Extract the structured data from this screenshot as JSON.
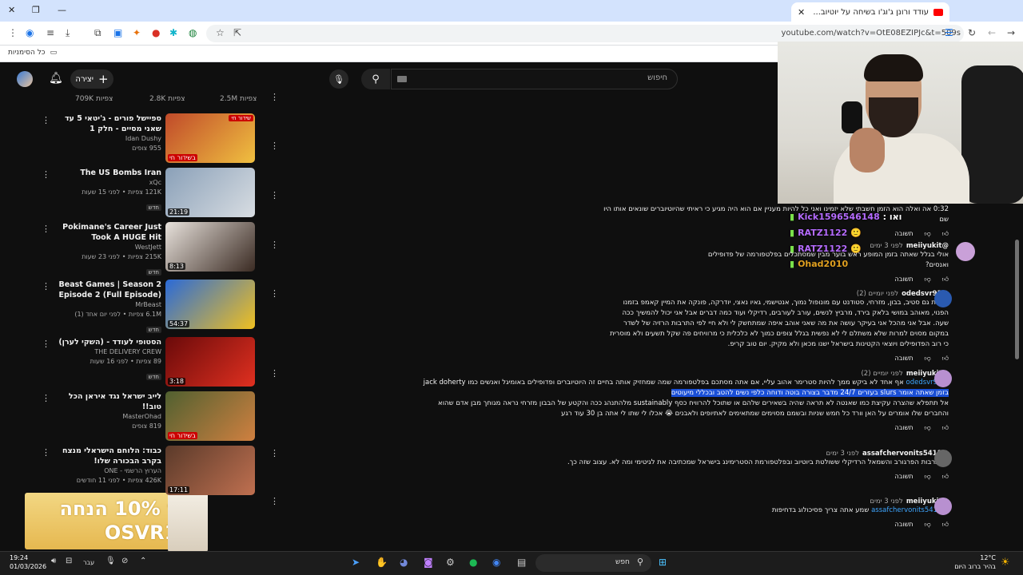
{
  "browser": {
    "tab_title": "עודד ורונן ג'וג'ו בשיחה על יוטיוב...",
    "url": "youtube.com/watch?v=OtE08EZIPJc&t=509s",
    "bookmarks_label": "כל הסימניות"
  },
  "header": {
    "create_label": "יצירה",
    "search_placeholder": "חיפוש"
  },
  "sidebar": {
    "top_views": [
      "709K צפיות",
      "2.8K צפיות",
      "2.5M צפיות"
    ],
    "videos": [
      {
        "title": "ספיישל פורים - ג'יטאי 5 עד שאני מסיים - חלק 1",
        "channel": "Idan Dushy",
        "stats": "955 צופים",
        "badge": "בשידור חי",
        "thumb_badge": "שידור חי"
      },
      {
        "title": "The US Bombs Iran",
        "channel": "xQc",
        "stats": "121K צפיות • לפני 15 שעות",
        "new": "חדש",
        "duration": "21:19"
      },
      {
        "title": "Pokimane's Career Just Took A HUGE Hit",
        "channel": "WestJett",
        "stats": "215K צפיות • לפני 23 שעות",
        "new": "חדש",
        "duration": "8:13"
      },
      {
        "title": "Beast Games | Season 2 Episode 2 (Full Episode)",
        "channel": "MrBeast",
        "stats": "6.1M צפיות • לפני יום אחד (1)",
        "new": "חדש",
        "duration": "54:37"
      },
      {
        "title": "הסטופי לעודד - (השקי לערן)",
        "channel": "THE DELIVERY CREW",
        "stats": "89 צפיות • לפני 16 שעות",
        "new": "חדש",
        "duration": "3:18"
      },
      {
        "title": "לייב ישראל נגד איראן הכל טוב!!",
        "channel": "MasterOhad",
        "stats": "819 צופים",
        "badge": "בשידור חי"
      },
      {
        "title": "כבוד: הלוחם הישראלי מנצח בקרב הבכורה שלו!",
        "channel": "הערוץ הרשמי - ONE",
        "stats": "426K צפיות • לפני 11 חודשים",
        "duration": "17:11"
      }
    ]
  },
  "ad": {
    "line1": "קוד 10% הנחה",
    "line2": "OSVR10"
  },
  "chat": [
    {
      "user": "Kick1596546148",
      "suffix": ": ואו"
    },
    {
      "user": "RATZ1122",
      "suffix": ""
    },
    {
      "user": "RATZ1122",
      "suffix": ""
    },
    {
      "user": "Ohad2010",
      "suffix": ""
    }
  ],
  "comments": [
    {
      "author": "",
      "time": "",
      "body": "0:32 אה ואלה הוא הזמן חשבתי שלא יזמינו ואני כל להיות מעניין אם הוא היה מגיע כי ראיתי שהיוטיוברים שונאים אותו היו שם",
      "reply": "תשובה"
    },
    {
      "author": "@meiiyukit",
      "time": "לפני 3 ימים",
      "body": "אולי בגלל שאתה בזמן המופע ראש בוער מבין שמסתכלים בפלטפורמה של פדופילים ואנסים?",
      "reply": "תשובה"
    },
    {
      "author": "@odedsvr95",
      "time": "לפני יומיים (2)",
      "body": "שכחת גם סטיב, בבון, מזרחי, סטודנט עם מונופול נמוך, אנטישמי, גאיו נאצי, יודרקה, פונקה את המיין קאמפ בזמנו הפנוי, מאוהב במושי בלאק בירד, מרביץ לנשים, עורב לעורבים, רדיקלי ועוד כמה דברים אבל אני יכול להמשיך ככה שעה. אבל אני מהכל אני בעיקר עושה את מה שאני אוהב איפה שמתחשק לי ולא חיי לפי התרבות הרזיה של לשדר במקום מסוים למרות שלא משתלם לי לא נפשית בגלל צופים כמוך לא כלכלית כי מרוויחים פה שקל תשעים ולא מוסרית כי רוב הפדופילים ויוצאי הקטינות בישראל ישנו מכאן ולא מקיק. יום טוב קריפ.",
      "reply": "תשובה"
    },
    {
      "author": "@meiiyukit",
      "time": "לפני יומיים (2)",
      "mention": "@odedsvr95",
      "body_pre": "אף אחד לא ביקש ממך להיות סטרימר אהוב עליי, אם אתה מסתכם בפלטפורמה שמה שמחזיק אותה בחיים זה היוטיוברים ופדופילים באומיגל ואנשים כמו jack doherty",
      "highlight": "בזמן שאתה אומר slurs בעזרים 24/7 מדבר בצורה בוטה ודוחה כלפי נשים להטב ובכללי מיעוטים",
      "body_post": "אל תתפלא שהצרה עקיצת כמו שאנטה לא תראה שהיה בשאירים שלהם או שתוכל להרוויח כסף sustainably מלהתנהג ככה והקטע של הבבון מזרחי נראה מגוחך מבן אדם שהוא והחברים שלו אומרים על האן וורד כל חמש שניות ובשמם מסוימים שמתאימים לאתיופים ולאבנים 😭 אכלו לי שתו לי אתה בן 30 עוד רגע",
      "reply": "תשובה"
    },
    {
      "author": "@assafchervonits5411",
      "time": "לפני 3 ימים",
      "body": "זה תרבות הפרגורב והשמאל הרדיקלי ששולטת ביוטיוב ובפלטפורמת הסטרימינג בישראל שמכתיבה את לגיטימי ומה לא. עצוב שזה כך.",
      "reply": "תשובה"
    },
    {
      "author": "@meiiyukit",
      "time": "לפני 3 ימים",
      "mention": "@assafchervonits5411",
      "body": "שמע אתה צריך פסיכולוג בדחיפות",
      "reply": "תשובה"
    }
  ],
  "taskbar": {
    "time": "19:24",
    "date": "01/03/2026",
    "lang": "עבר",
    "search_label": "חפש",
    "temp": "12°C",
    "weather": "בהיר ברוב היום"
  }
}
